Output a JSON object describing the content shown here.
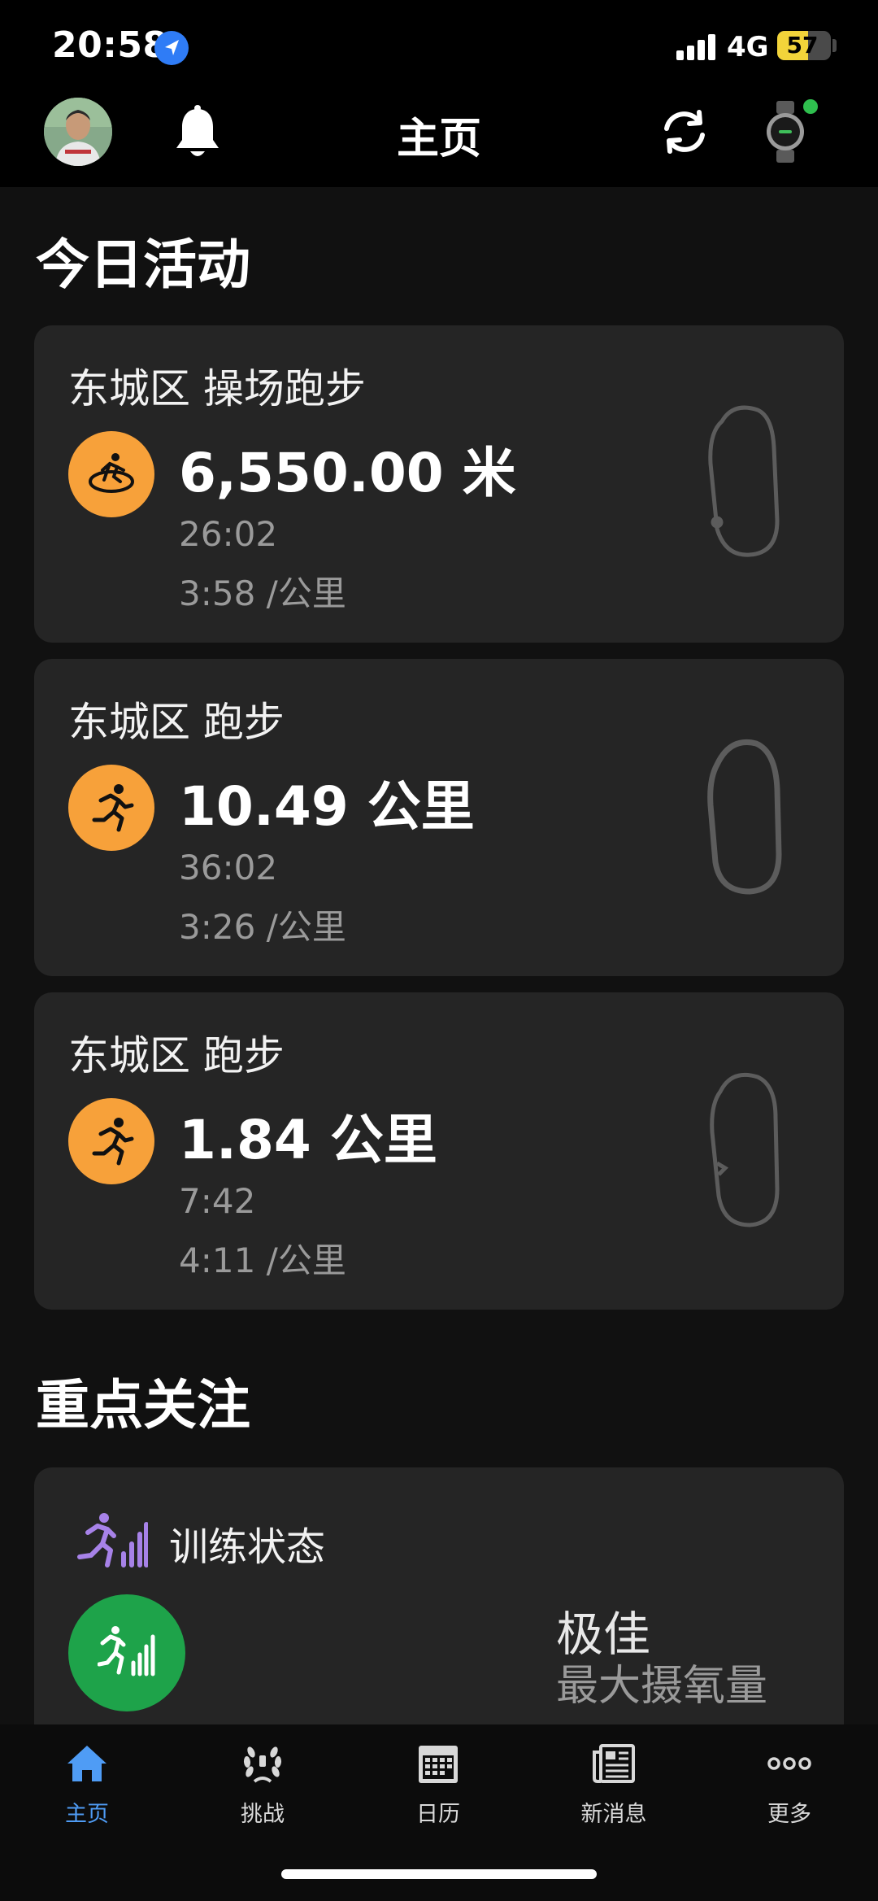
{
  "status_bar": {
    "time": "20:58",
    "network": "4G",
    "battery": "57",
    "battery_level": 0.57
  },
  "header": {
    "title": "主页"
  },
  "today": {
    "section_title": "今日活动",
    "activities": [
      {
        "title": "东城区 操场跑步",
        "type_icon": "track-running-icon",
        "distance": "6,550.00 米",
        "duration": "26:02",
        "pace": "3:58 /公里"
      },
      {
        "title": "东城区 跑步",
        "type_icon": "running-icon",
        "distance": "10.49 公里",
        "duration": "36:02",
        "pace": "3:26 /公里"
      },
      {
        "title": "东城区 跑步",
        "type_icon": "running-icon",
        "distance": "1.84 公里",
        "duration": "7:42",
        "pace": "4:11 /公里"
      }
    ]
  },
  "focus": {
    "section_title": "重点关注",
    "training_status": {
      "label": "训练状态",
      "status": "极佳",
      "metric": "最大摄氧量"
    }
  },
  "tabs": [
    {
      "label": "主页",
      "icon": "home-icon",
      "active": true
    },
    {
      "label": "挑战",
      "icon": "laurel-icon",
      "active": false
    },
    {
      "label": "日历",
      "icon": "calendar-icon",
      "active": false
    },
    {
      "label": "新消息",
      "icon": "newsfeed-icon",
      "active": false
    },
    {
      "label": "更多",
      "icon": "more-icon",
      "active": false
    }
  ],
  "colors": {
    "accent": "#4f9cf5",
    "activity_icon": "#f7a13a",
    "training_status": "#1ea34a",
    "card_bg": "#252525"
  }
}
